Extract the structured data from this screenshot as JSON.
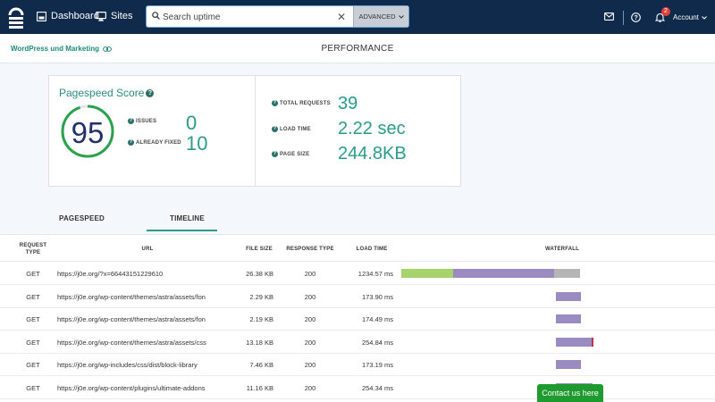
{
  "topbar": {
    "nav": [
      {
        "label": "Dashboard",
        "icon": "dashboard-icon"
      },
      {
        "label": "Sites",
        "icon": "monitor-icon"
      }
    ],
    "search_placeholder": "Search uptime",
    "advanced_label": "ADVANCED",
    "notification_count": "2",
    "account_label": "Account"
  },
  "subheader": {
    "site_name": "WordPress und Marketing",
    "page_title": "PERFORMANCE"
  },
  "score_card": {
    "pagespeed_title": "Pagespeed Score",
    "score": "95",
    "score_fraction": 0.95,
    "issues_label": "ISSUES",
    "issues_value": "0",
    "fixed_label": "ALREADY FIXED",
    "fixed_value": "10",
    "total_requests_label": "TOTAL REQUESTS",
    "total_requests_value": "39",
    "load_time_label": "LOAD TIME",
    "load_time_value": "2.22 sec",
    "page_size_label": "PAGE SIZE",
    "page_size_value": "244.8KB"
  },
  "tabs": [
    {
      "label": "PAGESPEED",
      "active": false
    },
    {
      "label": "TIMELINE",
      "active": true
    }
  ],
  "table": {
    "headers": {
      "type": "REQUEST TYPE",
      "url": "URL",
      "size": "FILE SIZE",
      "response": "RESPONSE TYPE",
      "load": "LOAD TIME",
      "waterfall": "WATERFALL"
    },
    "rows": [
      {
        "type": "GET",
        "url": "https://j0e.org/?x=66443151229610",
        "size": "26.38 KB",
        "code": "200",
        "time": "1234.57 ms"
      },
      {
        "type": "GET",
        "url": "https://j0e.org/wp-content/themes/astra/assets/fon",
        "size": "2.29 KB",
        "code": "200",
        "time": "173.90 ms"
      },
      {
        "type": "GET",
        "url": "https://j0e.org/wp-content/themes/astra/assets/fon",
        "size": "2.19 KB",
        "code": "200",
        "time": "174.49 ms"
      },
      {
        "type": "GET",
        "url": "https://j0e.org/wp-content/themes/astra/assets/css",
        "size": "13.18 KB",
        "code": "200",
        "time": "254.84 ms"
      },
      {
        "type": "GET",
        "url": "https://j0e.org/wp-includes/css/dist/block-library",
        "size": "7.46 KB",
        "code": "200",
        "time": "173.19 ms"
      },
      {
        "type": "GET",
        "url": "https://j0e.org/wp-content/plugins/ultimate-addons",
        "size": "11.16 KB",
        "code": "200",
        "time": "254.34 ms"
      }
    ]
  },
  "contact_label": "Contact us here",
  "colors": {
    "topbar": "#0f2a4a",
    "accent": "#2a9b8a",
    "score_ring": "#2aa14a",
    "wf_green": "#a6d46a",
    "wf_purple": "#9a8cc0",
    "wf_gray": "#b5b5b5",
    "contact": "#1e9a2e"
  }
}
